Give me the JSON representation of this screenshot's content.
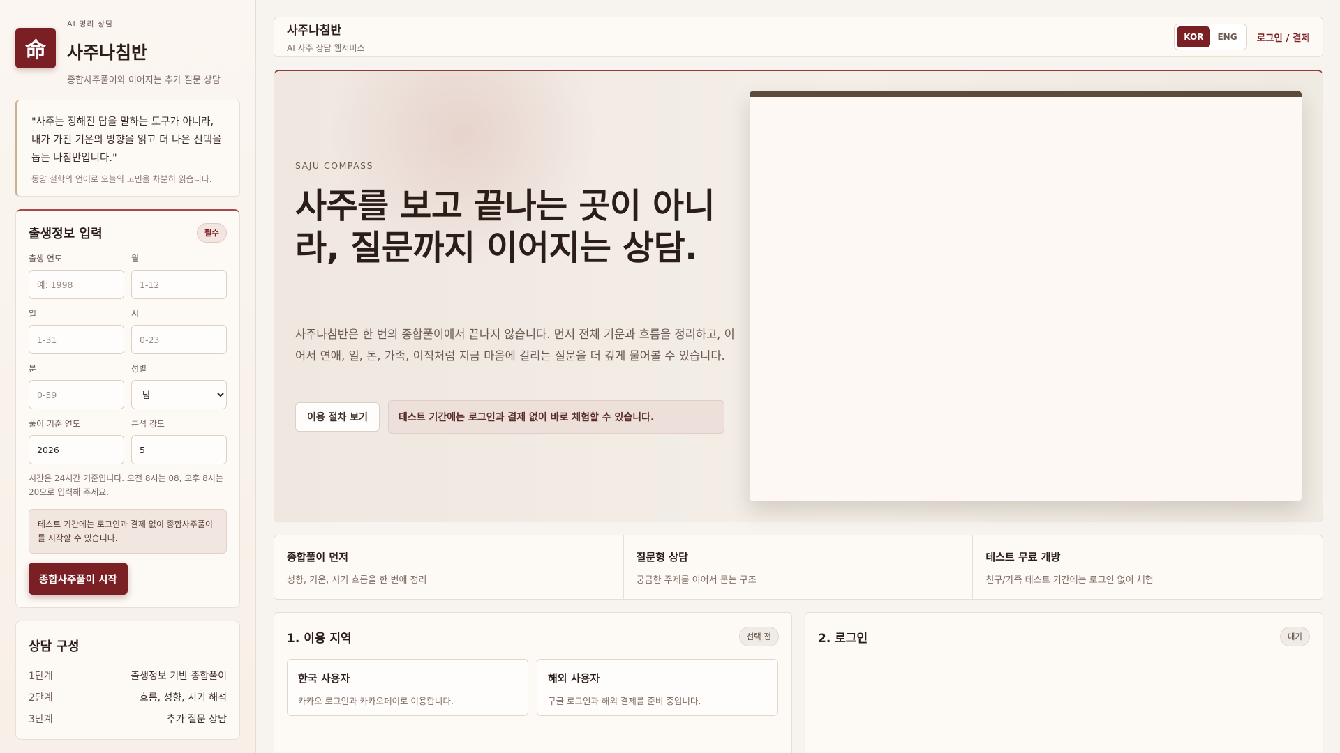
{
  "sidebar": {
    "brand": {
      "logo_glyph": "命",
      "eyebrow": "AI 명리 상담",
      "title": "사주나침반",
      "subtitle": "종합사주풀이와 이어지는 추가 질문 상담"
    },
    "quote": {
      "text": "\"사주는 정해진 답을 말하는 도구가 아니라, 내가 가진 기운의 방향을 읽고 더 나은 선택을 돕는 나침반입니다.\"",
      "note": "동양 철학의 언어로 오늘의 고민을 차분히 읽습니다."
    },
    "form": {
      "title": "출생정보 입력",
      "required_badge": "필수",
      "fields": {
        "year": {
          "label": "출생 연도",
          "placeholder": "예: 1998",
          "value": ""
        },
        "month": {
          "label": "월",
          "placeholder": "1-12",
          "value": ""
        },
        "day": {
          "label": "일",
          "placeholder": "1-31",
          "value": ""
        },
        "hour": {
          "label": "시",
          "placeholder": "0-23",
          "value": ""
        },
        "minute": {
          "label": "분",
          "placeholder": "0-59",
          "value": ""
        },
        "gender": {
          "label": "성별",
          "selected": "남"
        },
        "base_year": {
          "label": "풀이 기준 연도",
          "value": "2026"
        },
        "intensity": {
          "label": "분석 강도",
          "value": "5"
        }
      },
      "hint": "시간은 24시간 기준입니다. 오전 8시는 08, 오후 8시는 20으로 입력해 주세요.",
      "notice": "테스트 기간에는 로그인과 결제 없이 종합사주풀이를 시작할 수 있습니다.",
      "submit_label": "종합사주풀이 시작"
    },
    "steps": {
      "title": "상담 구성",
      "items": [
        {
          "key": "1단계",
          "value": "출생정보 기반 종합풀이"
        },
        {
          "key": "2단계",
          "value": "흐름, 성향, 시기 해석"
        },
        {
          "key": "3단계",
          "value": "추가 질문 상담"
        }
      ]
    }
  },
  "topbar": {
    "title": "사주나침반",
    "subtitle": "AI 사주 상담 웹서비스",
    "lang_kor": "KOR",
    "lang_eng": "ENG",
    "login_label": "로그인 / 결제"
  },
  "hero": {
    "eyebrow": "SAJU COMPASS",
    "title": "사주를 보고 끝나는 곳이 아니라, 질문까지 이어지는 상담.",
    "description": "사주나침반은 한 번의 종합풀이에서 끝나지 않습니다. 먼저 전체 기운과 흐름을 정리하고, 이어서 연애, 일, 돈, 가족, 이직처럼 지금 마음에 걸리는 질문을 더 깊게 물어볼 수 있습니다.",
    "process_button": "이용 절차 보기",
    "note": "테스트 기간에는 로그인과 결제 없이 바로 체험할 수 있습니다."
  },
  "features": [
    {
      "title": "종합풀이 먼저",
      "desc": "성향, 기운, 시기 흐름을 한 번에 정리"
    },
    {
      "title": "질문형 상담",
      "desc": "궁금한 주제를 이어서 묻는 구조"
    },
    {
      "title": "테스트 무료 개방",
      "desc": "친구/가족 테스트 기간에는 로그인 없이 체험"
    }
  ],
  "region_panel": {
    "title": "1. 이용 지역",
    "badge": "선택 전",
    "options": [
      {
        "title": "한국 사용자",
        "desc": "카카오 로그인과 카카오페이로 이용합니다."
      },
      {
        "title": "해외 사용자",
        "desc": "구글 로그인과 해외 결제를 준비 중입니다."
      }
    ]
  },
  "login_panel": {
    "title": "2. 로그인",
    "badge": "대기"
  },
  "colors": {
    "accent": "#7a1f24",
    "background": "#f7f3ee",
    "card": "#fdfaf6"
  }
}
